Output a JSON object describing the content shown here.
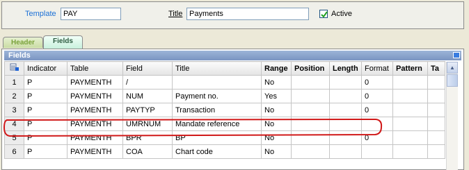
{
  "header": {
    "template_label": "Template",
    "template_value": "PAY",
    "title_label": "Title",
    "title_value": "Payments",
    "active_label": "Active",
    "active_checked": true
  },
  "tabs": [
    {
      "label": "Header",
      "selected": false
    },
    {
      "label": "Fields",
      "selected": true
    }
  ],
  "grid": {
    "title": "Fields",
    "columns": [
      "Indicator",
      "Table",
      "Field",
      "Title",
      "Range",
      "Position",
      "Length",
      "Format",
      "Pattern",
      "Ta"
    ],
    "rows": [
      {
        "num": "1",
        "cells": [
          "P",
          "PAYMENTH",
          "/",
          "",
          "No",
          "",
          "",
          "0",
          "",
          ""
        ]
      },
      {
        "num": "2",
        "cells": [
          "P",
          "PAYMENTH",
          "NUM",
          "Payment no.",
          "Yes",
          "",
          "",
          "0",
          "",
          ""
        ]
      },
      {
        "num": "3",
        "cells": [
          "P",
          "PAYMENTH",
          "PAYTYP",
          "Transaction",
          "No",
          "",
          "",
          "0",
          "",
          ""
        ]
      },
      {
        "num": "4",
        "cells": [
          "P",
          "PAYMENTH",
          "UMRNUM",
          "Mandate reference",
          "No",
          "",
          "",
          "",
          "",
          ""
        ]
      },
      {
        "num": "5",
        "cells": [
          "P",
          "PAYMENTH",
          "BPR",
          "BP",
          "No",
          "",
          "",
          "0",
          "",
          ""
        ]
      },
      {
        "num": "6",
        "cells": [
          "P",
          "PAYMENTH",
          "COA",
          "Chart code",
          "No",
          "",
          "",
          "",
          "",
          ""
        ]
      }
    ]
  },
  "annotation": {
    "highlighted_row": "4",
    "color": "#d01818"
  },
  "colors": {
    "accent_blue": "#1a6fd6",
    "grid_title_bg": "#7a95c2"
  }
}
